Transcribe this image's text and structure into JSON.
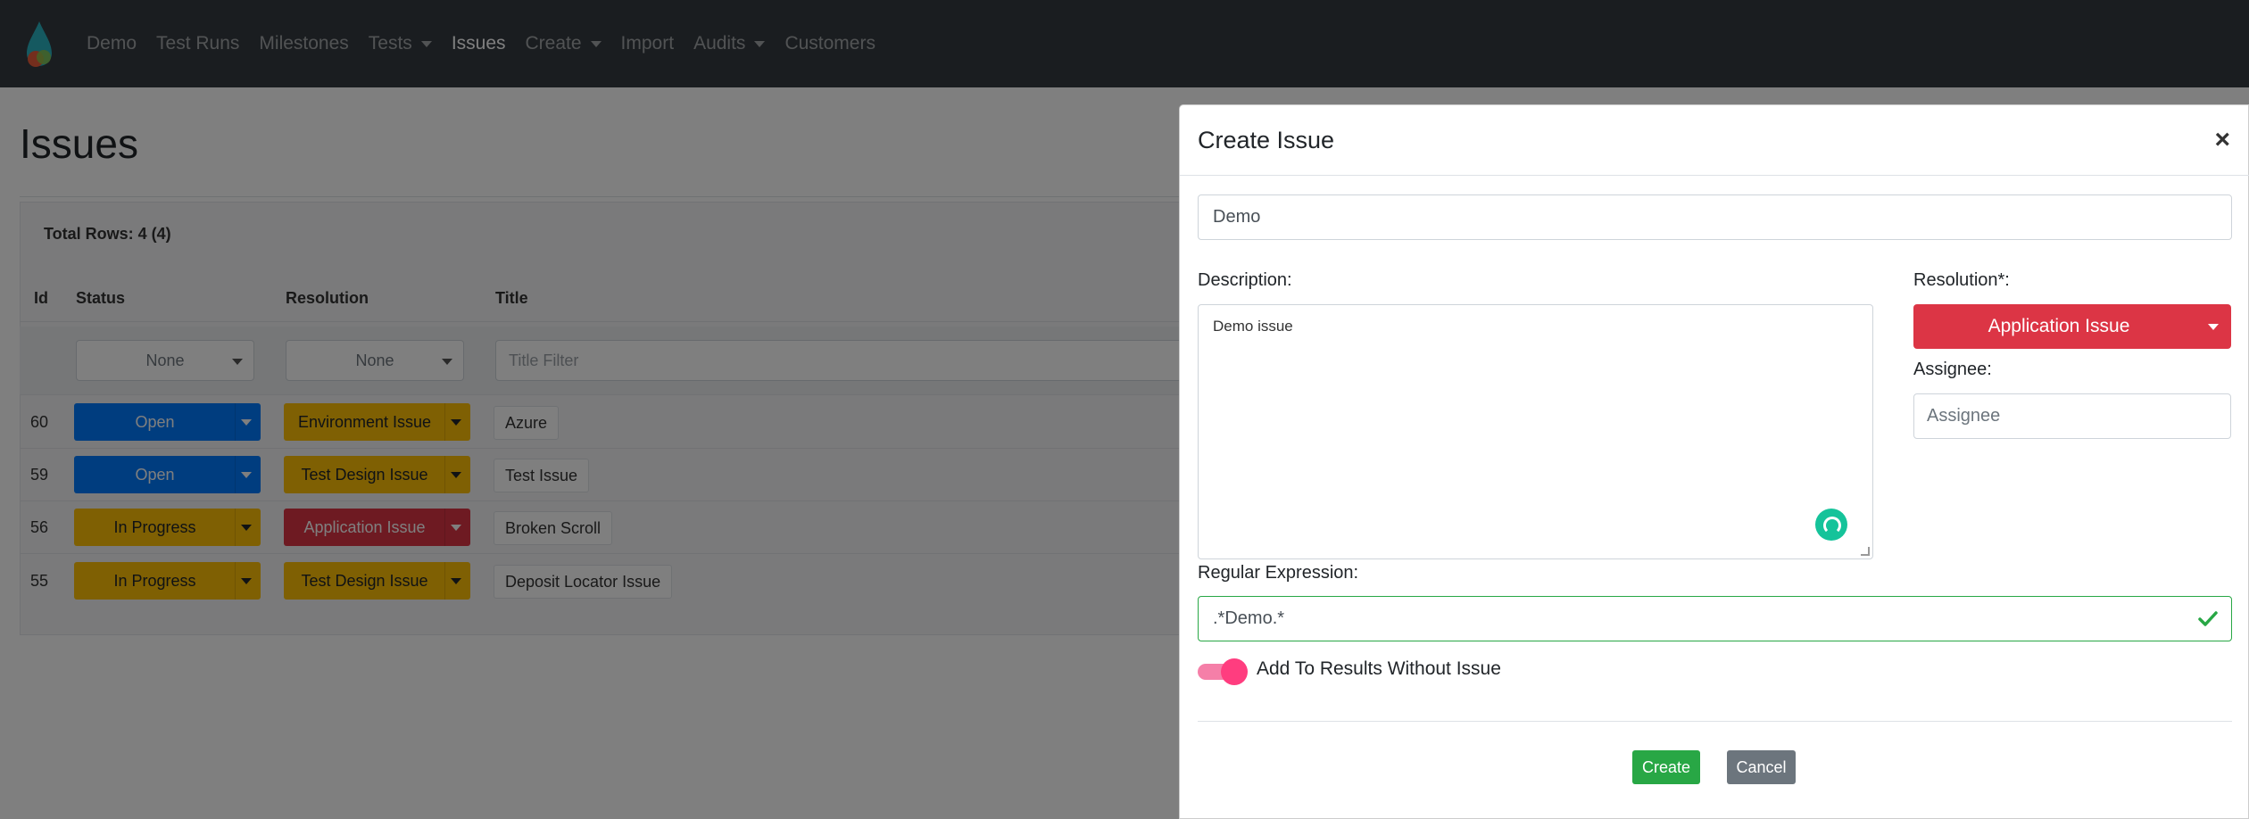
{
  "nav": {
    "logo_icon": "droplet-logo-icon",
    "items": [
      {
        "label": "Demo",
        "dropdown": false,
        "active": false
      },
      {
        "label": "Test Runs",
        "dropdown": false,
        "active": false
      },
      {
        "label": "Milestones",
        "dropdown": false,
        "active": false
      },
      {
        "label": "Tests",
        "dropdown": true,
        "active": false
      },
      {
        "label": "Issues",
        "dropdown": false,
        "active": true
      },
      {
        "label": "Create",
        "dropdown": true,
        "active": false
      },
      {
        "label": "Import",
        "dropdown": false,
        "active": false
      },
      {
        "label": "Audits",
        "dropdown": true,
        "active": false
      },
      {
        "label": "Customers",
        "dropdown": false,
        "active": false
      }
    ]
  },
  "page": {
    "title": "Issues",
    "total_rows": "Total Rows: 4 (4)",
    "columns": [
      "Id",
      "Status",
      "Resolution",
      "Title"
    ],
    "filters": {
      "status": "None",
      "resolution": "None",
      "title_placeholder": "Title Filter"
    },
    "rows": [
      {
        "id": "60",
        "status": "Open",
        "resolution": "Environment Issue",
        "title": "Azure"
      },
      {
        "id": "59",
        "status": "Open",
        "resolution": "Test Design Issue",
        "title": "Test Issue"
      },
      {
        "id": "56",
        "status": "In Progress",
        "resolution": "Application Issue",
        "title": "Broken Scroll"
      },
      {
        "id": "55",
        "status": "In Progress",
        "resolution": "Test Design Issue",
        "title": "Deposit Locator Issue"
      }
    ]
  },
  "modal": {
    "title": "Create Issue",
    "close_glyph": "×",
    "name_value": "Demo",
    "description_label": "Description:",
    "description_value": "Demo issue",
    "resolution_label": "Resolution*:",
    "resolution_value": "Application Issue",
    "assignee_label": "Assignee:",
    "assignee_placeholder": "Assignee",
    "regex_label": "Regular Expression:",
    "regex_value": ".*Demo.*",
    "toggle_label": "Add To Results Without Issue",
    "toggle_on": true,
    "create_label": "Create",
    "cancel_label": "Cancel"
  },
  "colors": {
    "navbar": "#343a40",
    "blue_status": "#007bff",
    "yellow_status": "#ffc107",
    "red_resolution": "#dc3545",
    "success": "#28a745",
    "secondary": "#6c757d",
    "toggle_pink": "#ff3d7f",
    "grammar_green": "#15c39a"
  }
}
